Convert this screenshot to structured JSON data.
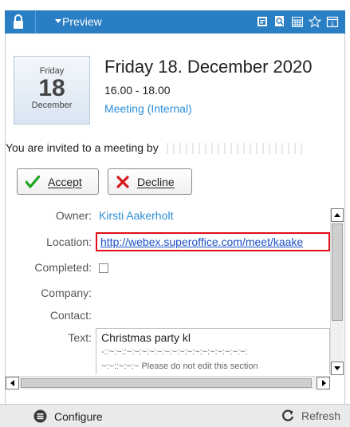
{
  "header": {
    "title": "Preview",
    "icons": [
      "lock-icon",
      "dropdown-caret-icon",
      "document-icon",
      "search-document-icon",
      "calendar-grid-icon",
      "star-icon",
      "calendar-day-icon"
    ],
    "accent_color": "#2a7fc4"
  },
  "date_card": {
    "weekday": "Friday",
    "day": "18",
    "month": "December"
  },
  "event": {
    "title": "Friday 18. December 2020",
    "time": "16.00 - 18.00",
    "type": "Meeting (Internal)"
  },
  "invite": {
    "text": "You are invited to a meeting by"
  },
  "actions": {
    "accept_label": "Accept",
    "decline_label": "Decline"
  },
  "fields": {
    "owner_label": "Owner:",
    "owner_value": "Kirsti Aakerholt",
    "location_label": "Location:",
    "location_value": "http://webex.superoffice.com/meet/kaake",
    "completed_label": "Completed:",
    "company_label": "Company:",
    "contact_label": "Contact:",
    "text_label": "Text:",
    "text_line1": "Christmas party kl",
    "text_line2": "-::~:~::~:~:~:~:~:~:~:~:~:~:~:~:~:~:~:~:",
    "text_line3": "~:~::~:~:~ Please do not edit this section"
  },
  "footer": {
    "configure_label": "Configure",
    "refresh_label": "Refresh"
  }
}
